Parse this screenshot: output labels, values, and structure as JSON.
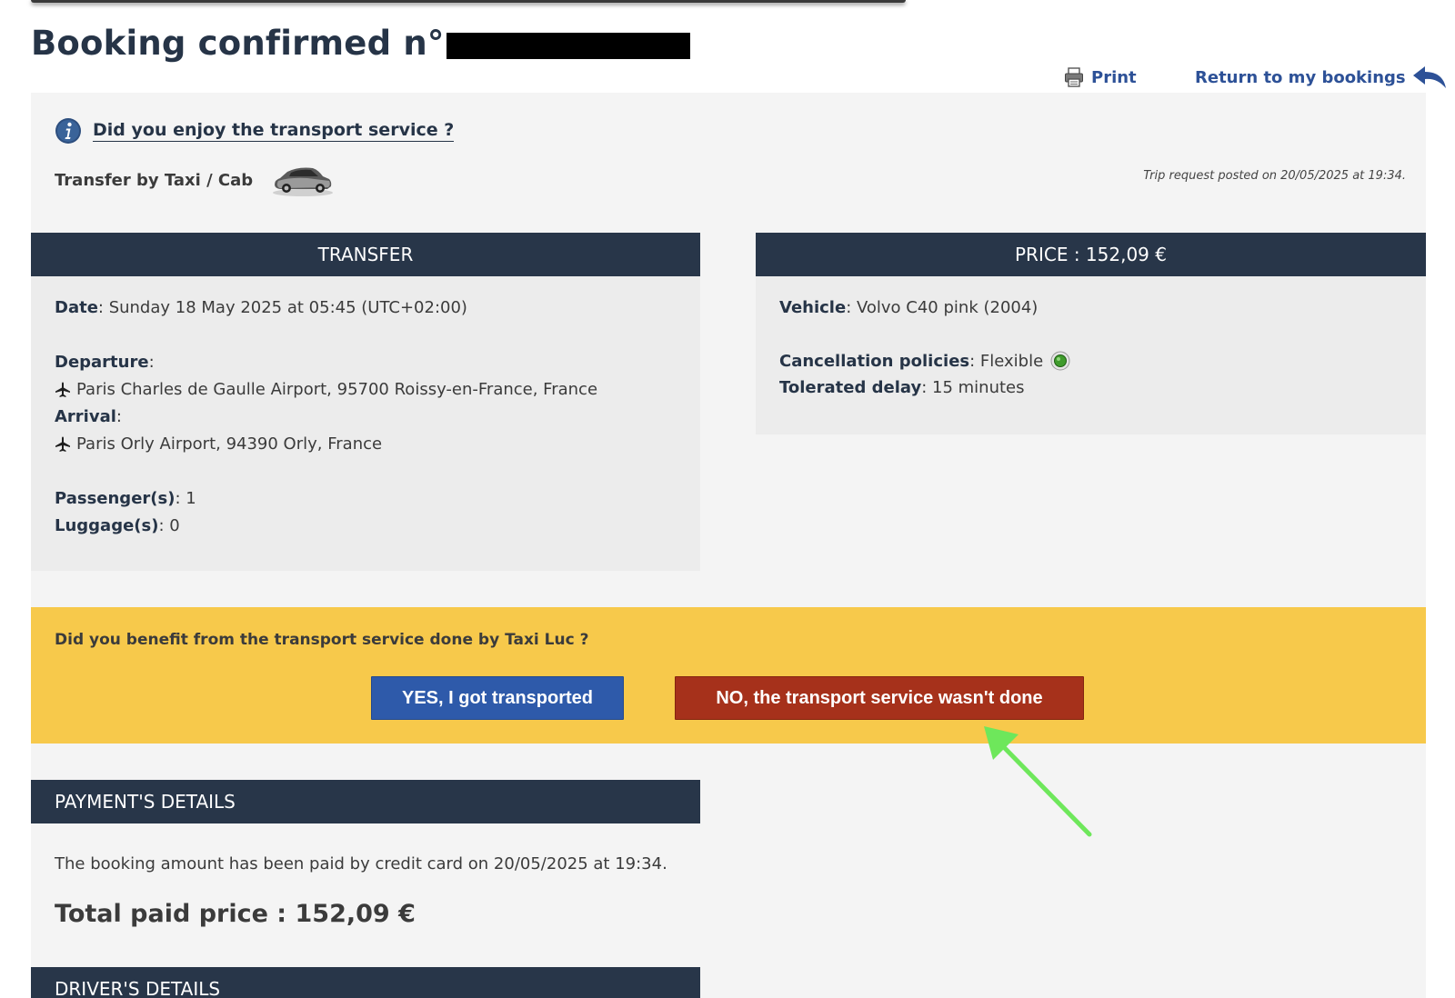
{
  "page": {
    "title": "Booking confirmed n°",
    "print_label": "Print",
    "return_label": "Return to my bookings"
  },
  "feedback": {
    "enjoy_question": "Did you enjoy the transport service ?",
    "service_type": "Transfer by Taxi / Cab",
    "trip_posted": "Trip request posted on 20/05/2025 at 19:34."
  },
  "transfer": {
    "heading": "TRANSFER",
    "date_label": "Date",
    "date_value": " : Sunday 18 May 2025 at 05:45 (UTC+02:00)",
    "departure_label": "Departure",
    "departure_colon": " :",
    "departure_value": "Paris Charles de Gaulle Airport, 95700 Roissy-en-France, France",
    "arrival_label": "Arrival",
    "arrival_colon": " :",
    "arrival_value": "Paris Orly Airport, 94390 Orly, France",
    "passengers_label": "Passenger(s)",
    "passengers_value": " : 1",
    "luggage_label": "Luggage(s)",
    "luggage_value": " : 0"
  },
  "price": {
    "heading": "PRICE : 152,09 €",
    "vehicle_label": "Vehicle",
    "vehicle_value": " : Volvo C40 pink (2004)",
    "cancellation_label": "Cancellation policies",
    "cancellation_value": " : Flexible",
    "delay_label": "Tolerated delay",
    "delay_value": " : 15 minutes"
  },
  "confirmation": {
    "question": "Did you benefit from the transport service done by Taxi Luc ?",
    "yes_label": "YES, I got transported",
    "no_label": "NO, the transport service wasn't done"
  },
  "payment": {
    "heading": "PAYMENT'S DETAILS",
    "text": "The booking amount has been paid by credit card on 20/05/2025 at 19:34.",
    "total": "Total paid price : 152,09 €"
  },
  "driver": {
    "heading": "DRIVER'S DETAILS"
  },
  "colors": {
    "header_bar": "#283649",
    "link_blue": "#2d5197",
    "banner_yellow": "#f7c94b",
    "yes_button": "#2e5aaa",
    "no_button": "#a6311b",
    "annotation_arrow": "#6ee75b",
    "status_green": "#3f9b2c"
  },
  "icons": {
    "print": "printer-icon",
    "return": "back-arrow-icon",
    "info": "info-icon",
    "car": "car-icon",
    "plane": "plane-icon",
    "flexible": "green-dot-icon",
    "annotation": "green-arrow-icon"
  }
}
